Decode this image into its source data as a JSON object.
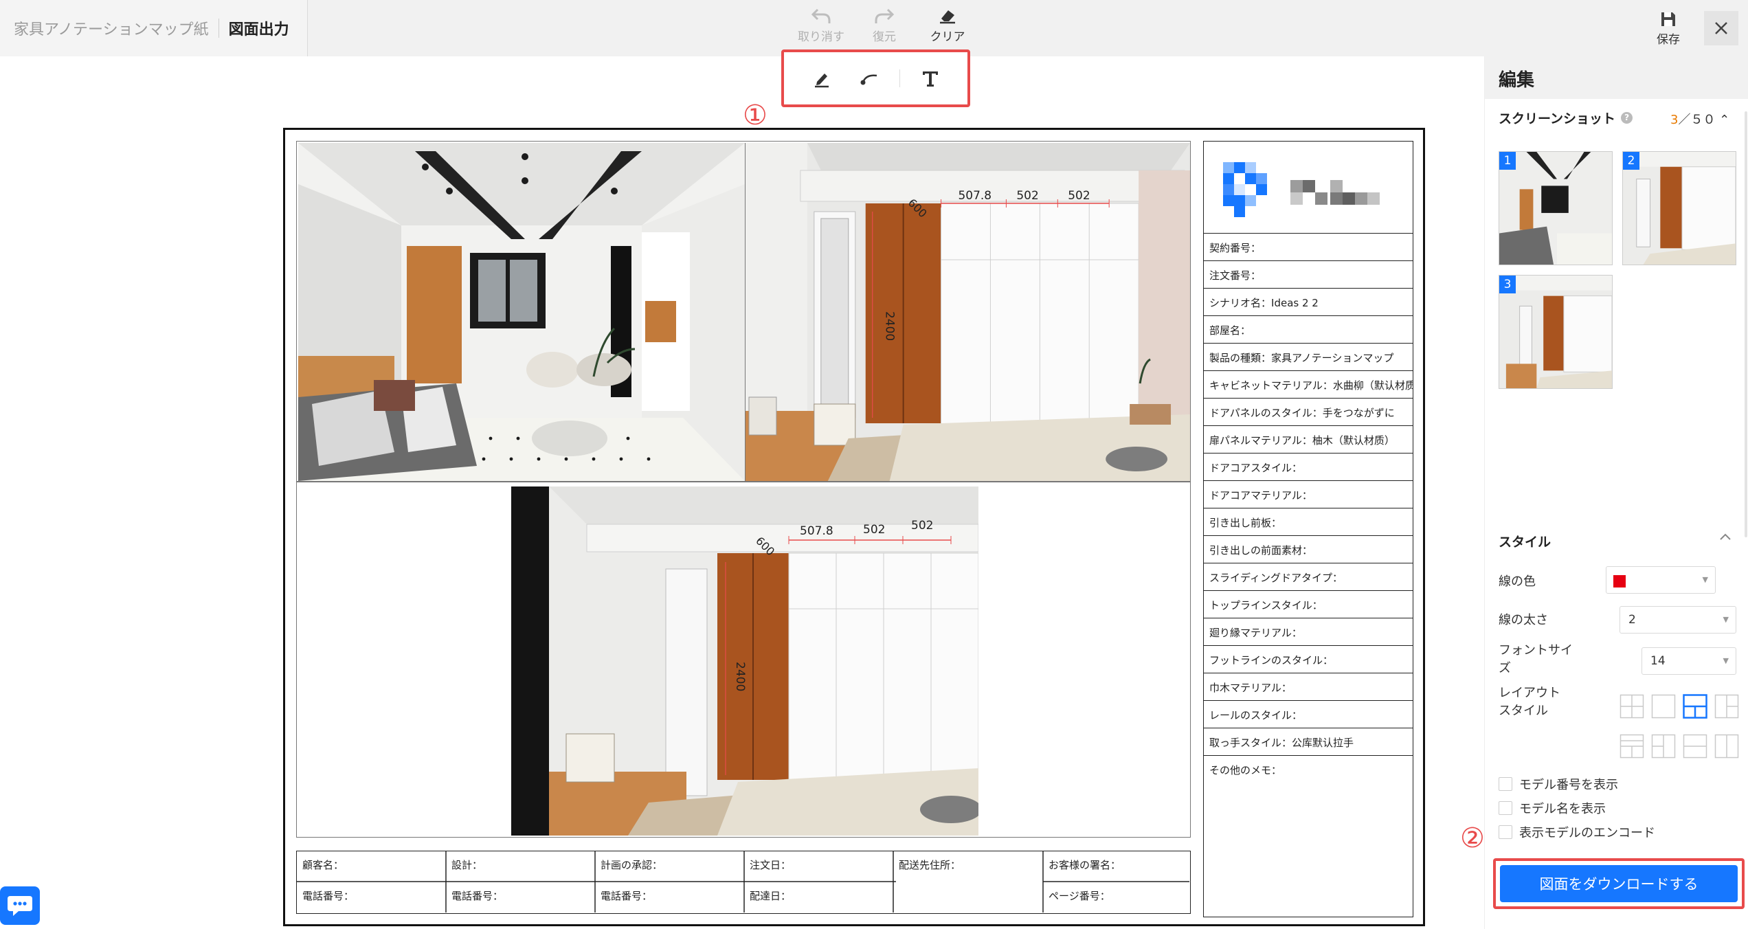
{
  "header": {
    "project_name": "家具アノテーションマップ紙",
    "current_page": "図面出力",
    "actions": [
      {
        "label": "取り消す",
        "icon": "undo-icon",
        "enabled": false
      },
      {
        "label": "復元",
        "icon": "redo-icon",
        "enabled": false
      },
      {
        "label": "クリア",
        "icon": "eraser-icon",
        "enabled": true
      }
    ],
    "save_label": "保存",
    "close_icon": "close-icon"
  },
  "draw_tools": {
    "tools": [
      "pen-icon",
      "line-icon",
      "text-icon"
    ],
    "marker": "①"
  },
  "sheet": {
    "info_rows": [
      {
        "label": "契約番号：",
        "value": ""
      },
      {
        "label": "注文番号：",
        "value": ""
      },
      {
        "label": "シナリオ名：",
        "value": "Ideas 2 2"
      },
      {
        "label": "部屋名：",
        "value": ""
      },
      {
        "label": "製品の種類：",
        "value": "家具アノテーションマップ"
      },
      {
        "label": "キャビネットマテリアル：",
        "value": "水曲柳（默认材质）"
      },
      {
        "label": "ドアパネルのスタイル：",
        "value": "手をつながずに"
      },
      {
        "label": "扉パネルマテリアル：",
        "value": "柚木（默认材质）"
      },
      {
        "label": "ドアコアスタイル：",
        "value": ""
      },
      {
        "label": "ドアコアマテリアル：",
        "value": ""
      },
      {
        "label": "引き出し前板：",
        "value": ""
      },
      {
        "label": "引き出しの前面素材：",
        "value": ""
      },
      {
        "label": "スライディングドアタイプ：",
        "value": ""
      },
      {
        "label": "トップラインスタイル：",
        "value": ""
      },
      {
        "label": "廻り縁マテリアル：",
        "value": ""
      },
      {
        "label": "フットラインのスタイル：",
        "value": ""
      },
      {
        "label": "巾木マテリアル：",
        "value": ""
      },
      {
        "label": "レールのスタイル：",
        "value": ""
      },
      {
        "label": "取っ手スタイル：",
        "value": "公库默认拉手"
      }
    ],
    "memo_label": "その他のメモ：",
    "bottom": {
      "customer": "顧客名：",
      "design": "設計：",
      "plan_approval": "計画の承認：",
      "order_date": "注文日：",
      "delivery_address": "配送先住所：",
      "customer_signature": "お客様の署名：",
      "phone_1": "電話番号：",
      "phone_2": "電話番号：",
      "phone_3": "電話番号：",
      "delivery_date": "配達日：",
      "page_number": "ページ番号："
    },
    "dimensions": {
      "width_1": "507.8",
      "width_2": "502",
      "width_3": "502",
      "height": "2400",
      "depth": "600"
    }
  },
  "panel": {
    "title": "編集",
    "screenshot_title": "スクリーンショット",
    "help_icon": "?",
    "screenshot_current": "3",
    "screenshot_total": "／５０",
    "thumbnails": [
      "1",
      "2",
      "3"
    ],
    "style_title": "スタイル",
    "line_color_label": "線の色",
    "line_color": "#e60012",
    "line_width_label": "線の太さ",
    "line_width_value": "2",
    "font_size_label": "フォントサイズ",
    "font_size_value": "14",
    "layout_label": "レイアウトスタイル",
    "layout_selected": 2,
    "show_model_number": "モデル番号を表示",
    "show_model_name": "モデル名を表示",
    "show_model_encode": "表示モデルのエンコード",
    "download_label": "図面をダウンロードする",
    "marker": "②"
  },
  "colors": {
    "accent": "#1677ff",
    "highlight": "#e84b4b",
    "count_current": "#e87a00"
  }
}
